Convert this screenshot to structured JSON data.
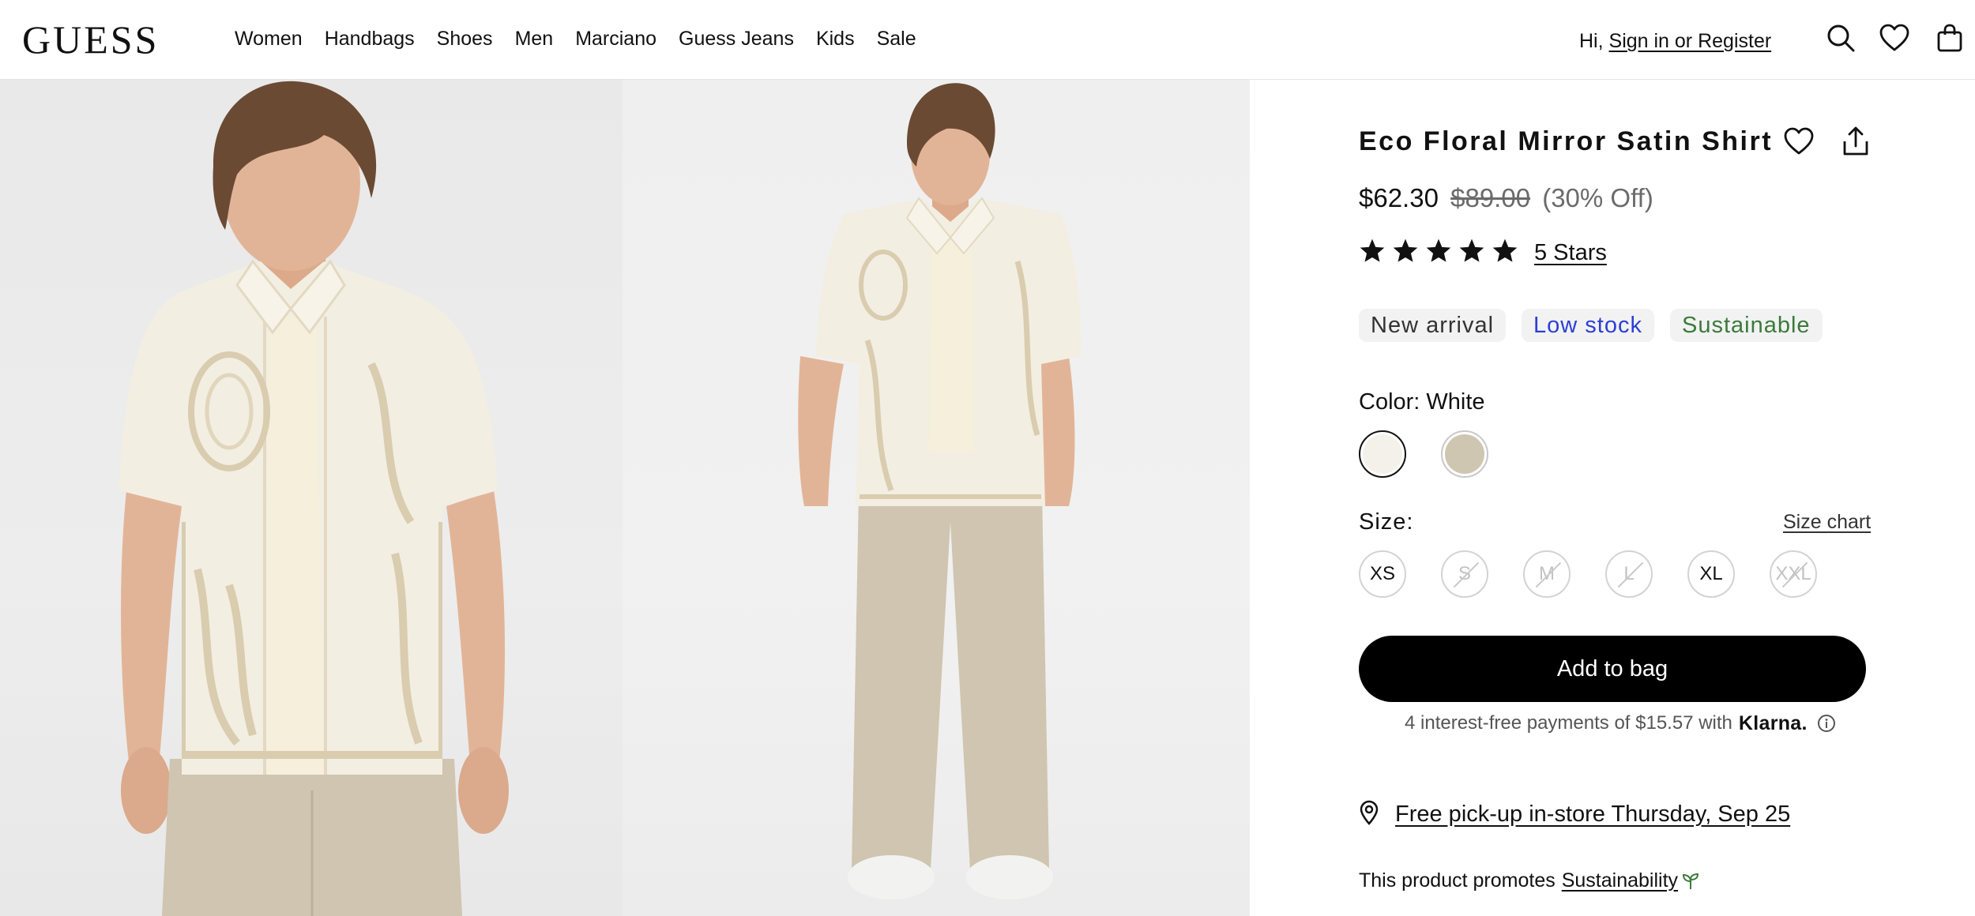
{
  "header": {
    "logo": "GUESS",
    "nav": [
      "Women",
      "Handbags",
      "Shoes",
      "Men",
      "Marciano",
      "Guess Jeans",
      "Kids",
      "Sale"
    ],
    "greeting": "Hi,",
    "signin_label": "Sign in or Register"
  },
  "product": {
    "title": "Eco Floral Mirror Satin Shirt",
    "price_current": "$62.30",
    "price_original": "$89.00",
    "price_discount": "(30% Off)",
    "rating": 5,
    "rating_label": "5 Stars",
    "badges": [
      {
        "label": "New arrival",
        "color": "#333333"
      },
      {
        "label": "Low stock",
        "color": "#2b3fd6"
      },
      {
        "label": "Sustainable",
        "color": "#3b7a3b"
      }
    ],
    "color_label": "Color:",
    "color_value": "White",
    "swatches": [
      {
        "name": "White",
        "color": "#f4f1ea",
        "selected": true
      },
      {
        "name": "Beige",
        "color": "#cfc6b2",
        "selected": false
      }
    ],
    "size_label": "Size:",
    "size_chart_label": "Size chart",
    "sizes": [
      {
        "label": "XS",
        "available": true
      },
      {
        "label": "S",
        "available": false
      },
      {
        "label": "M",
        "available": false
      },
      {
        "label": "L",
        "available": false
      },
      {
        "label": "XL",
        "available": true
      },
      {
        "label": "XXL",
        "available": false
      }
    ],
    "add_to_bag_label": "Add to bag",
    "klarna_text": "4 interest-free payments of $15.57 with",
    "klarna_brand": "Klarna.",
    "pickup_text": "Free pick-up in-store Thursday, Sep 25",
    "promo_text": "This product promotes",
    "promo_link": "Sustainability"
  },
  "colors": {
    "accent": "#000000",
    "shirt": "#f3eee2",
    "shirt_print": "#d9ccaf",
    "pants": "#cfc5b0",
    "skin": "#e2b497",
    "hair": "#6b4a33",
    "sustain_green": "#3b7a3b"
  }
}
